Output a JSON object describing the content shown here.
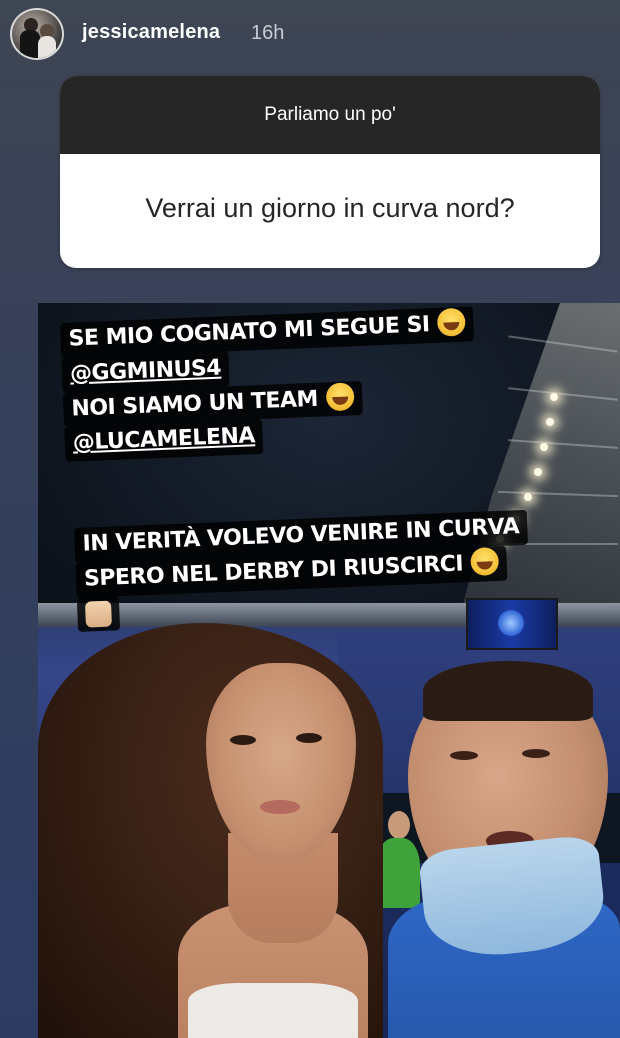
{
  "story": {
    "username": "jessicamelena",
    "time_ago": "16h"
  },
  "question_sticker": {
    "header": "Parliamo un po'",
    "question": "Verrai un giorno in curva nord?"
  },
  "captions": {
    "block1": {
      "line1": "SE MIO COGNATO MI SEGUE SI",
      "mention1": "@GGMINUS4",
      "line3": "NOI SIAMO UN TEAM",
      "mention2": "@LUCAMELENA"
    },
    "block2": {
      "line1": "IN VERITÀ VOLEVO VENIRE IN CURVA",
      "line2": "SPERO NEL DERBY DI RIUSCIRCI"
    },
    "emoji_names": [
      "tears-of-joy-emoji",
      "folded-hands-emoji"
    ]
  },
  "colors": {
    "question_header_bg": "#262626",
    "caption_bg": "#000000",
    "caption_text": "#ffffff"
  }
}
